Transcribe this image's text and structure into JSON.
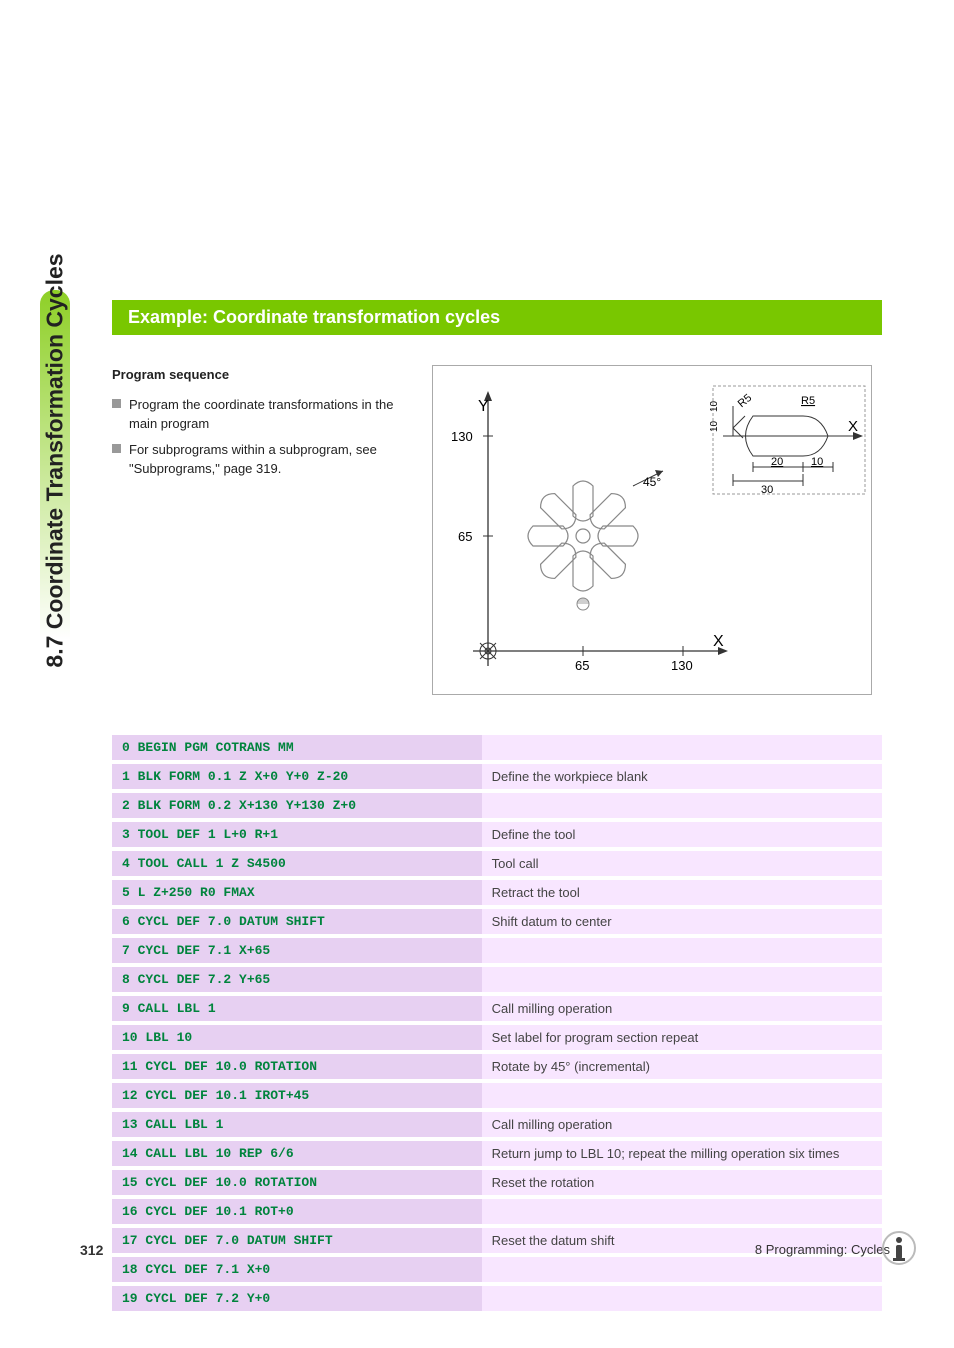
{
  "side_tab": "8.7 Coordinate Transformation Cycles",
  "example_title": "Example: Coordinate transformation cycles",
  "program_sequence_heading": "Program sequence",
  "bullets": [
    "Program the coordinate transformations in the main program",
    "For subprograms within a subprogram, see \"Subprograms,\" page 319."
  ],
  "diagram": {
    "y_label": "Y",
    "x_label_right": "X",
    "x_label_bottom": "X",
    "y_tick_130": "130",
    "y_tick_65": "65",
    "x_tick_65": "65",
    "x_tick_130": "130",
    "angle_label": "45°",
    "detail_r5_1": "R5",
    "detail_r5_2": "R5",
    "detail_10_a": "10",
    "detail_10_b": "10",
    "detail_20": "20",
    "detail_10_c": "10",
    "detail_30": "30"
  },
  "code": [
    {
      "line": "0 BEGIN PGM COTRANS MM",
      "desc": ""
    },
    {
      "line": "1 BLK FORM 0.1 Z X+0 Y+0 Z-20",
      "desc": "Define the workpiece blank"
    },
    {
      "line": "2 BLK FORM 0.2 X+130 Y+130 Z+0",
      "desc": ""
    },
    {
      "line": "3 TOOL DEF 1 L+0 R+1",
      "desc": "Define the tool"
    },
    {
      "line": "4 TOOL CALL 1 Z S4500",
      "desc": "Tool call"
    },
    {
      "line": "5 L Z+250 R0 FMAX",
      "desc": "Retract the tool"
    },
    {
      "line": "6 CYCL DEF 7.0 DATUM SHIFT",
      "desc": "Shift datum to center"
    },
    {
      "line": "7 CYCL DEF 7.1 X+65",
      "desc": ""
    },
    {
      "line": "8 CYCL DEF 7.2 Y+65",
      "desc": ""
    },
    {
      "line": "9 CALL LBL 1",
      "desc": "Call milling operation"
    },
    {
      "line": "10 LBL 10",
      "desc": "Set label for program section repeat"
    },
    {
      "line": "11 CYCL DEF 10.0 ROTATION",
      "desc": "Rotate by 45° (incremental)"
    },
    {
      "line": "12 CYCL DEF 10.1 IROT+45",
      "desc": ""
    },
    {
      "line": "13 CALL LBL 1",
      "desc": "Call milling operation"
    },
    {
      "line": "14 CALL LBL 10 REP 6/6",
      "desc": "Return jump to LBL 10; repeat the milling operation six times"
    },
    {
      "line": "15 CYCL DEF 10.0 ROTATION",
      "desc": "Reset the rotation"
    },
    {
      "line": "16 CYCL DEF 10.1 ROT+0",
      "desc": ""
    },
    {
      "line": "17 CYCL DEF 7.0 DATUM SHIFT",
      "desc": "Reset the datum shift"
    },
    {
      "line": "18 CYCL DEF 7.1 X+0",
      "desc": ""
    },
    {
      "line": "19 CYCL DEF 7.2 Y+0",
      "desc": ""
    }
  ],
  "footer": {
    "page_number": "312",
    "chapter": "8 Programming: Cycles"
  }
}
